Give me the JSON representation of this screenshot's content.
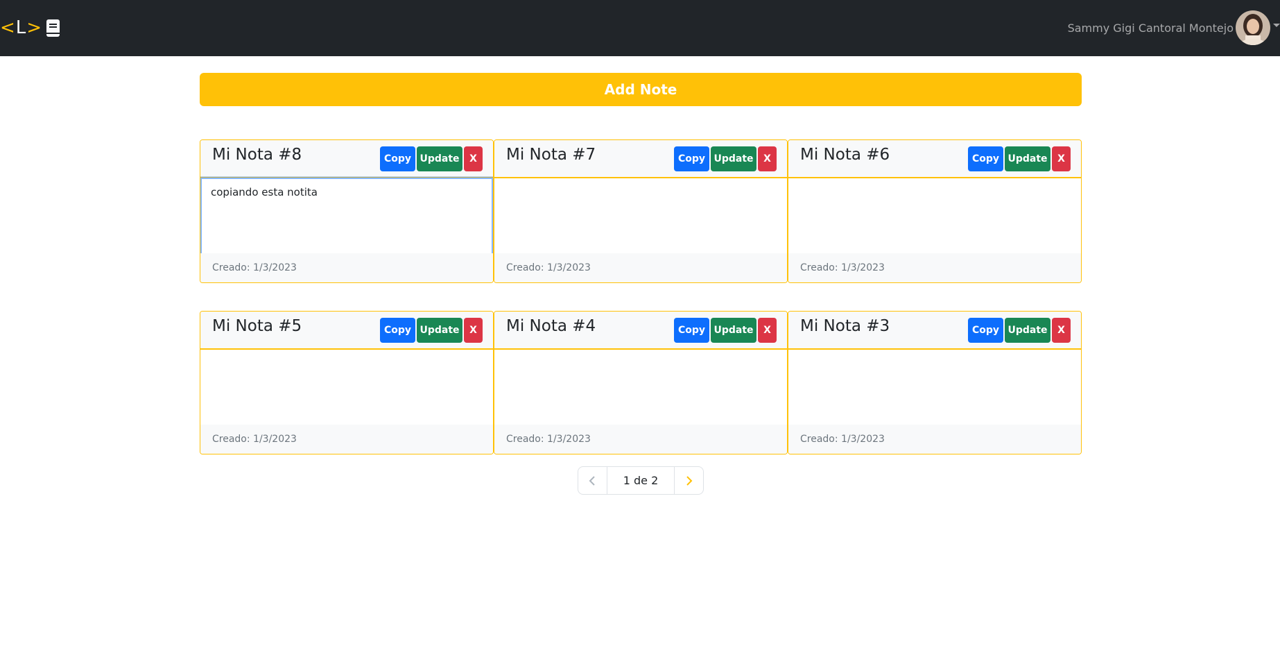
{
  "navbar": {
    "brand_left": "<",
    "brand_mid": "L",
    "brand_right": ">",
    "user_name": "Sammy Gigi Cantoral Montejo"
  },
  "add_note_label": "Add Note",
  "buttons": {
    "copy": "Copy",
    "update": "Update",
    "delete": "X"
  },
  "notes": [
    {
      "title": "Mi Nota #8",
      "content": "copiando esta notita",
      "created": "Creado: 1/3/2023"
    },
    {
      "title": "Mi Nota #7",
      "content": "",
      "created": "Creado: 1/3/2023"
    },
    {
      "title": "Mi Nota #6",
      "content": "",
      "created": "Creado: 1/3/2023"
    },
    {
      "title": "Mi Nota #5",
      "content": "",
      "created": "Creado: 1/3/2023"
    },
    {
      "title": "Mi Nota #4",
      "content": "",
      "created": "Creado: 1/3/2023"
    },
    {
      "title": "Mi Nota #3",
      "content": "",
      "created": "Creado: 1/3/2023"
    }
  ],
  "pagination": {
    "label": "1 de 2"
  },
  "colors": {
    "accent": "#ffc107",
    "navbar": "#212529",
    "copy": "#0d6efd",
    "update": "#198754",
    "delete": "#dc3545"
  }
}
